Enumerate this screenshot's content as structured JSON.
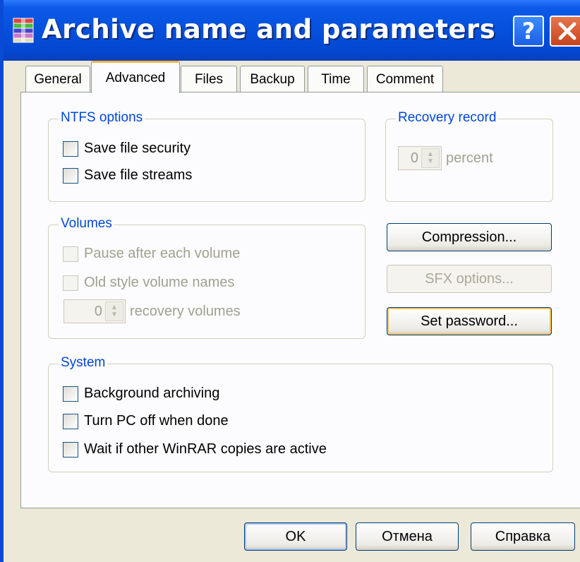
{
  "window": {
    "title": "Archive name and parameters",
    "help_label": "?",
    "colors": {
      "titlebar": "#0550dc",
      "accent": "#0046d5",
      "tab_highlight": "#f7b643"
    }
  },
  "tabs": [
    {
      "label": "General"
    },
    {
      "label": "Advanced",
      "active": true
    },
    {
      "label": "Files"
    },
    {
      "label": "Backup"
    },
    {
      "label": "Time"
    },
    {
      "label": "Comment"
    }
  ],
  "ntfs": {
    "title": "NTFS options",
    "save_security": "Save file security",
    "save_streams": "Save file streams"
  },
  "recovery": {
    "title": "Recovery record",
    "value": "0",
    "suffix": "percent"
  },
  "volumes": {
    "title": "Volumes",
    "pause": "Pause after each volume",
    "old_style": "Old style volume names",
    "recovery_value": "0",
    "recovery_suffix": "recovery volumes"
  },
  "buttons": {
    "compression": "Compression...",
    "sfx": "SFX options...",
    "password": "Set password..."
  },
  "system": {
    "title": "System",
    "background": "Background archiving",
    "turn_off": "Turn PC off when done",
    "wait": "Wait if other WinRAR copies are active"
  },
  "footer": {
    "ok": "OK",
    "cancel": "Отмена",
    "help": "Справка"
  }
}
